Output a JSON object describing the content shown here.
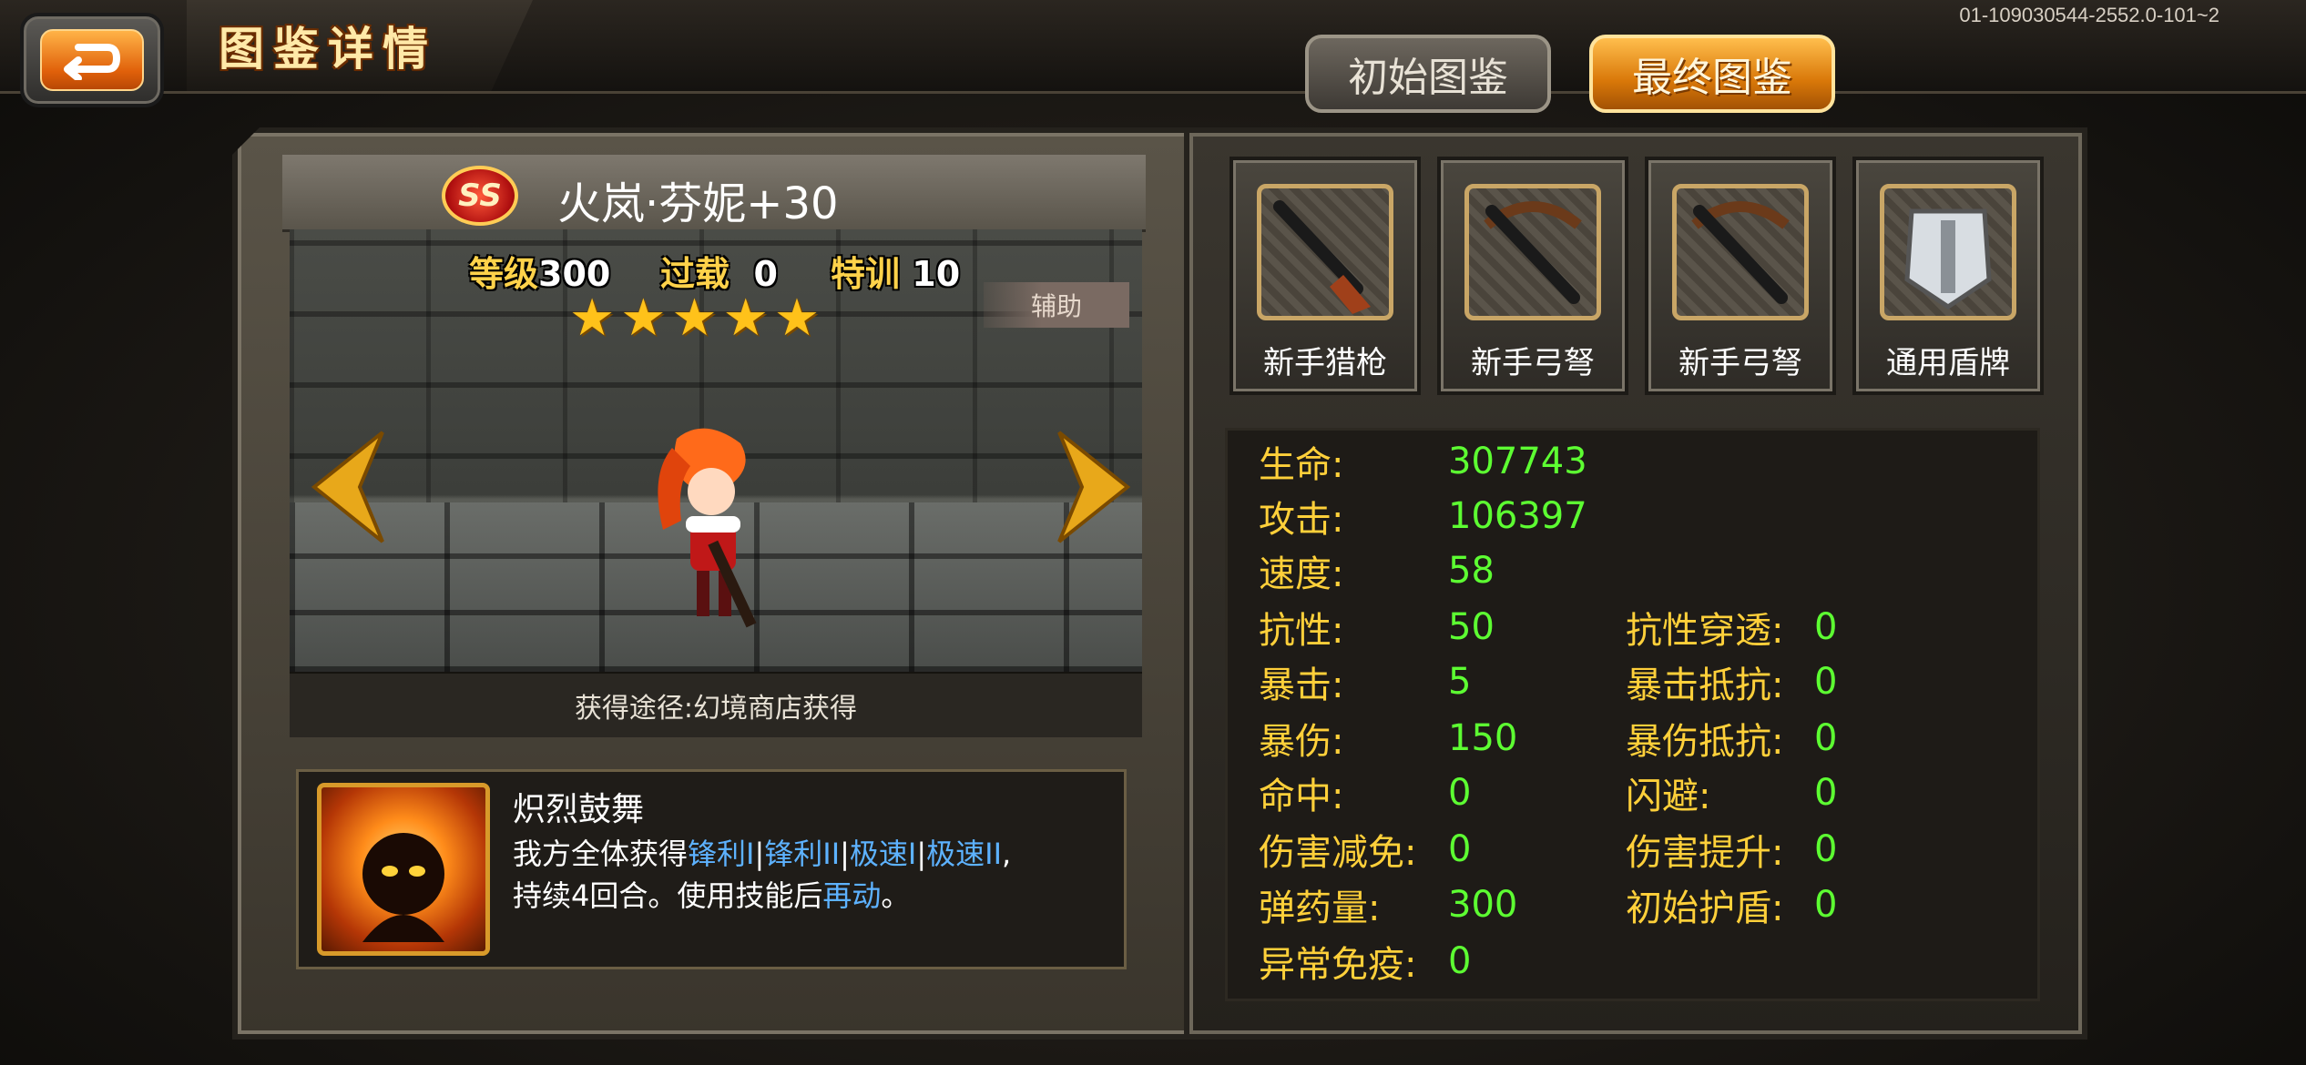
{
  "header": {
    "title": "图鉴详情",
    "version": "01-109030544-2552.0-101~2",
    "tabs": [
      {
        "label": "初始图鉴",
        "active": false
      },
      {
        "label": "最终图鉴",
        "active": true
      }
    ]
  },
  "hero": {
    "rank": "SS",
    "name": "火岚·芬妮+30",
    "level_label": "等级",
    "level": "300",
    "overload_label": "过载",
    "overload": "0",
    "training_label": "特训",
    "training": "10",
    "stars": 5,
    "role": "辅助",
    "source": "获得途径:幻境商店获得"
  },
  "skill": {
    "name": "炽烈鼓舞",
    "desc_prefix": "我方全体获得",
    "buffs": [
      "锋利I",
      "锋利II",
      "极速I",
      "极速II"
    ],
    "buff_sep": "|",
    "desc_mid": ",",
    "desc_line2_prefix": "持续4回合。使用技能后",
    "desc_line2_buff": "再动",
    "desc_line2_suffix": "。"
  },
  "equipment": [
    {
      "label": "新手猎枪",
      "icon": "shotgun-icon"
    },
    {
      "label": "新手弓弩",
      "icon": "crossbow-icon"
    },
    {
      "label": "新手弓弩",
      "icon": "crossbow-icon"
    },
    {
      "label": "通用盾牌",
      "icon": "shield-icon"
    }
  ],
  "attributes": {
    "left": [
      {
        "label": "生命:",
        "value": "307743"
      },
      {
        "label": "攻击:",
        "value": "106397"
      },
      {
        "label": "速度:",
        "value": "58"
      },
      {
        "label": "抗性:",
        "value": "50"
      },
      {
        "label": "暴击:",
        "value": "5"
      },
      {
        "label": "暴伤:",
        "value": "150"
      },
      {
        "label": "命中:",
        "value": "0"
      },
      {
        "label": "伤害减免:",
        "value": "0"
      },
      {
        "label": "弹药量:",
        "value": "300"
      },
      {
        "label": "异常免疫:",
        "value": "0"
      }
    ],
    "right": [
      {
        "label": "抗性穿透:",
        "value": "0"
      },
      {
        "label": "暴击抵抗:",
        "value": "0"
      },
      {
        "label": "暴伤抵抗:",
        "value": "0"
      },
      {
        "label": "闪避:",
        "value": "0"
      },
      {
        "label": "伤害提升:",
        "value": "0"
      },
      {
        "label": "初始护盾:",
        "value": "0"
      }
    ]
  },
  "colors": {
    "accent_orange": "#e0600a",
    "stat_label": "#ffd03a",
    "stat_value": "#5dff32",
    "buff_text": "#5db2ff"
  }
}
